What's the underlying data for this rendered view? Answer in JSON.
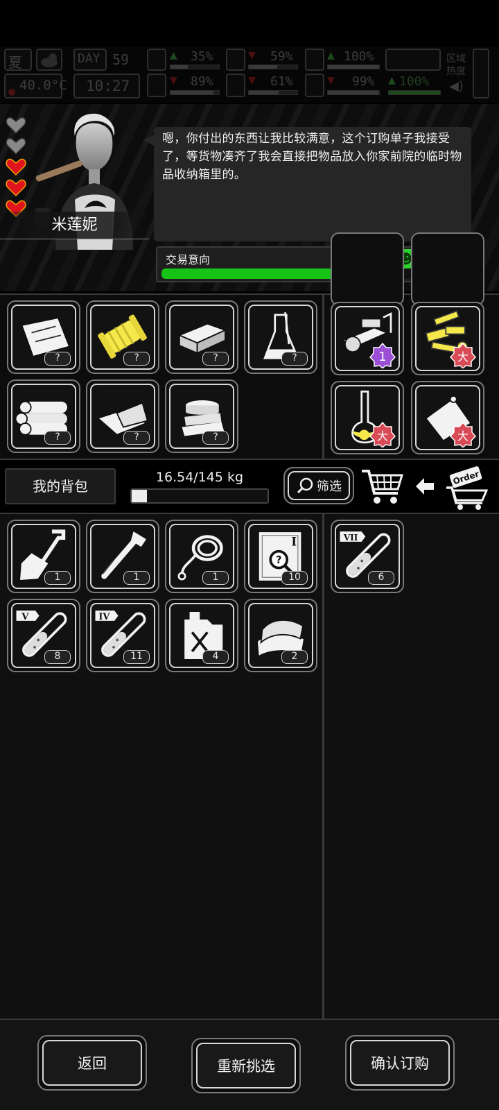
{
  "status": {
    "season": "夏",
    "day_label": "DAY",
    "day": "59",
    "temperature": "40.0°C",
    "time": "10:27",
    "stats_top": [
      {
        "icon": "medkit-icon",
        "value": "35%",
        "level": 0.35,
        "trend": "up"
      },
      {
        "icon": "stomach-icon",
        "value": "59%",
        "level": 0.59,
        "trend": "down"
      },
      {
        "icon": "mask-icon",
        "value": "100%",
        "level": 1.0,
        "trend": "up"
      }
    ],
    "stats_bottom": [
      {
        "icon": "brain-icon",
        "value": "89%",
        "level": 0.89,
        "trend": "down"
      },
      {
        "icon": "water-drop-icon",
        "value": "61%",
        "level": 0.61,
        "trend": "down"
      },
      {
        "icon": "heart-icon",
        "value": "99%",
        "level": 0.99,
        "trend": "down"
      },
      {
        "icon": "stamina-icon",
        "value": "100%",
        "level": 1.0,
        "trend": "up"
      }
    ],
    "zone_heat_label": "区域热度"
  },
  "npc": {
    "name": "米莲妮",
    "hearts": [
      "grey",
      "grey",
      "red",
      "red",
      "red"
    ],
    "dialogue": "嗯，你付出的东西让我比较满意，这个订购单子我接受了，等货物凑齐了我会直接把物品放入你家前院的临时物品收纳箱里的。",
    "trade_intent_label": "交易意向",
    "trade_intent_level": 0.8
  },
  "offered_items": [
    {
      "icon": "paper-sheet-icon",
      "count": "?"
    },
    {
      "icon": "yellow-spool-icon",
      "count": "?"
    },
    {
      "icon": "brick-block-icon",
      "count": "?"
    },
    {
      "icon": "lab-flask-icon",
      "count": "?"
    },
    {
      "icon": "logs-icon",
      "count": "?"
    },
    {
      "icon": "cloth-sheets-icon",
      "count": "?"
    },
    {
      "icon": "tape-rolls-icon",
      "count": "?"
    }
  ],
  "requested_items": [
    {
      "icon": "machine-part-icon",
      "badge": "1",
      "badge_color": "#9a4fd6"
    },
    {
      "icon": "gold-parts-icon",
      "badge": "大",
      "badge_color": "#d84a56"
    },
    {
      "icon": "yellow-flask-icon",
      "badge": "大",
      "badge_color": "#d84a56"
    },
    {
      "icon": "paper-scroll-icon",
      "badge": "大",
      "badge_color": "#d84a56"
    }
  ],
  "backpack": {
    "title": "我的背包",
    "weight": "16.54/145 kg",
    "weight_fraction": 0.114,
    "filter_label": "筛选"
  },
  "inventory_items": [
    {
      "icon": "shovel-icon",
      "count": "1"
    },
    {
      "icon": "hatchet-icon",
      "count": "1"
    },
    {
      "icon": "rope-icon",
      "count": "1"
    },
    {
      "icon": "blueprint-icon",
      "count": "10",
      "tier": "I"
    },
    {
      "icon": "test-tube-v-icon",
      "count": "8",
      "tier": "V"
    },
    {
      "icon": "test-tube-iv-icon",
      "count": "11",
      "tier": "IV"
    },
    {
      "icon": "fuel-can-icon",
      "count": "4"
    },
    {
      "icon": "fabric-icon",
      "count": "2"
    }
  ],
  "order_items": [
    {
      "icon": "test-tube-vii-icon",
      "count": "6",
      "tier": "VII"
    }
  ],
  "buttons": {
    "back": "返回",
    "reselect": "重新挑选",
    "confirm": "确认订购"
  }
}
